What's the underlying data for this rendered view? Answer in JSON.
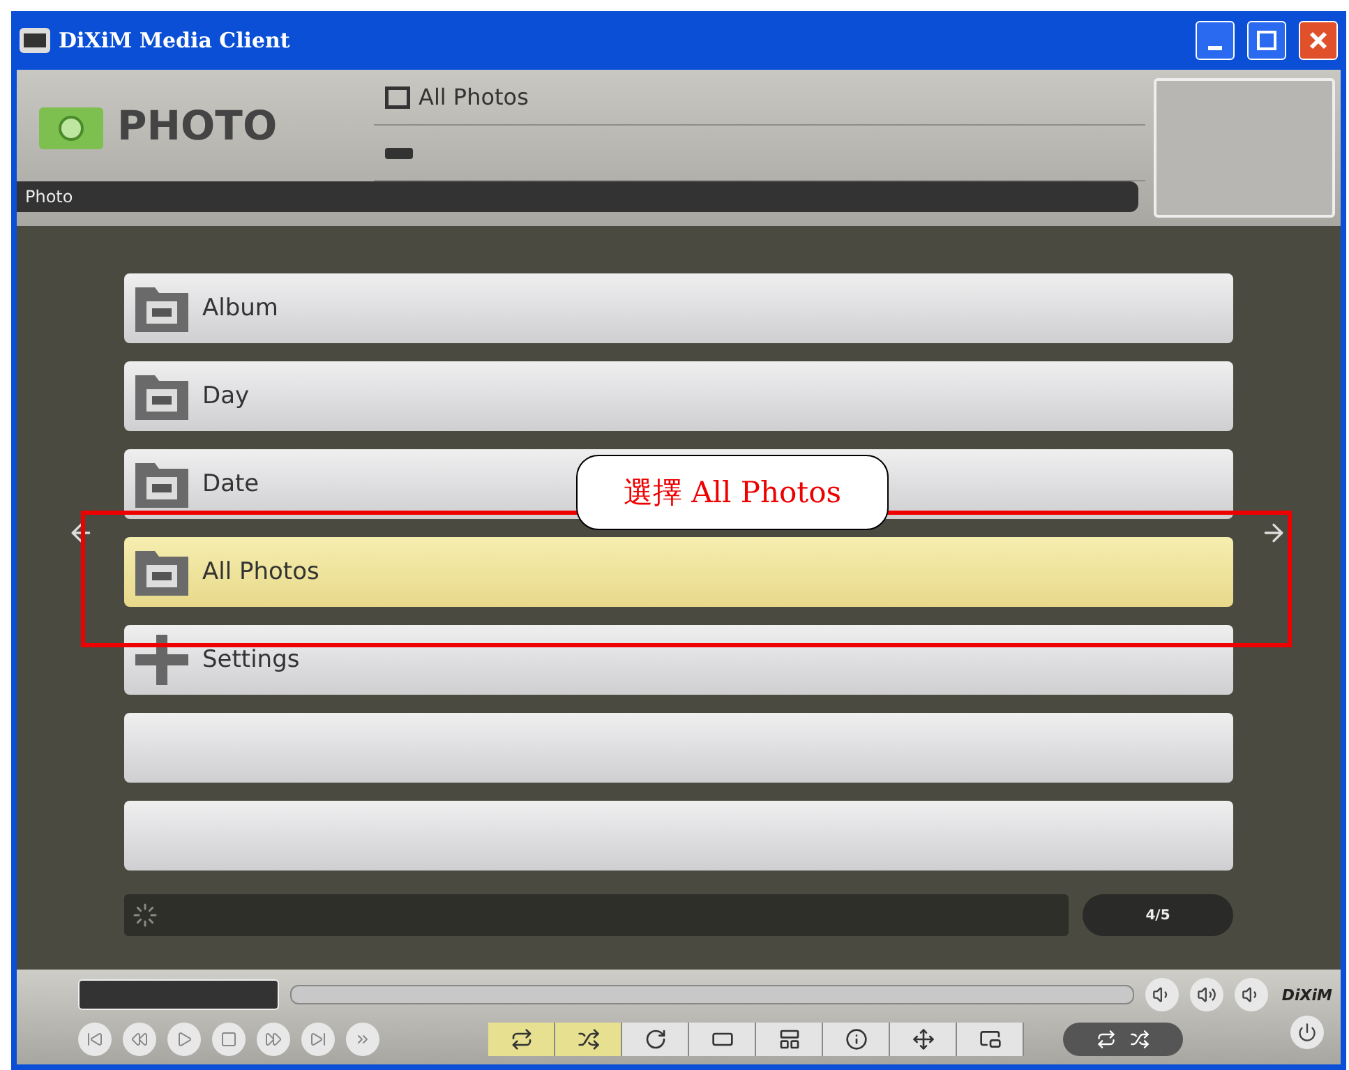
{
  "window": {
    "title": "DiXiM Media Client"
  },
  "header": {
    "section": "PHOTO",
    "path": "All Photos",
    "breadcrumb": "Photo"
  },
  "menu": [
    {
      "kind": "folder",
      "label": "Album",
      "selected": false
    },
    {
      "kind": "folder",
      "label": "Day",
      "selected": false
    },
    {
      "kind": "folder",
      "label": "Date",
      "selected": false
    },
    {
      "kind": "folder",
      "label": "All Photos",
      "selected": true
    },
    {
      "kind": "settings",
      "label": "Settings",
      "selected": false
    },
    {
      "kind": "empty",
      "selected": false
    },
    {
      "kind": "empty",
      "selected": false
    }
  ],
  "status": {
    "page": "4/5"
  },
  "annotation": {
    "text": "選擇 All Photos"
  },
  "toolbar": [
    {
      "on": true
    },
    {
      "on": true
    },
    {
      "on": false
    },
    {
      "on": false
    },
    {
      "on": false
    },
    {
      "on": false
    },
    {
      "on": false
    },
    {
      "on": false
    }
  ],
  "logo": "DiXiM"
}
